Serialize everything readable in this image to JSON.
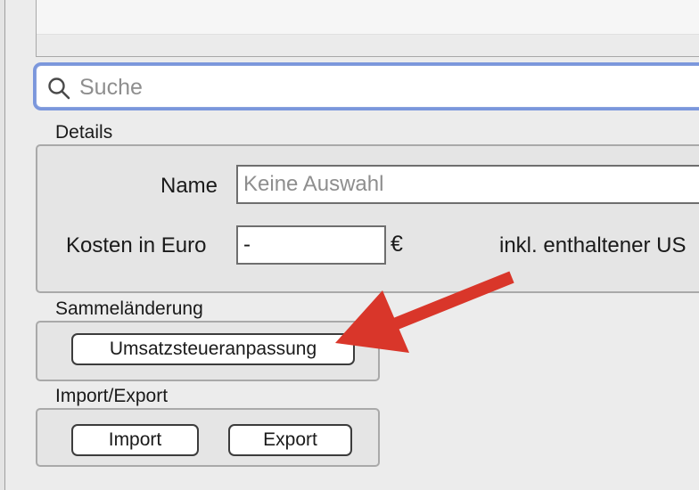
{
  "search": {
    "placeholder": "Suche"
  },
  "details": {
    "section_label": "Details",
    "name_label": "Name",
    "name_placeholder": "Keine Auswahl",
    "cost_label": "Kosten in Euro",
    "cost_value": "-",
    "currency_symbol": "€",
    "vat_label": "inkl. enthaltener US"
  },
  "bulk_change": {
    "section_label": "Sammeländerung",
    "vat_adjust_button": "Umsatzsteueranpassung"
  },
  "import_export": {
    "section_label": "Import/Export",
    "import_button": "Import",
    "export_button": "Export"
  },
  "annotation": {
    "arrow_color": "#d9362a"
  },
  "colors": {
    "focus_ring": "#7b97dc",
    "window_background": "#ececec"
  }
}
